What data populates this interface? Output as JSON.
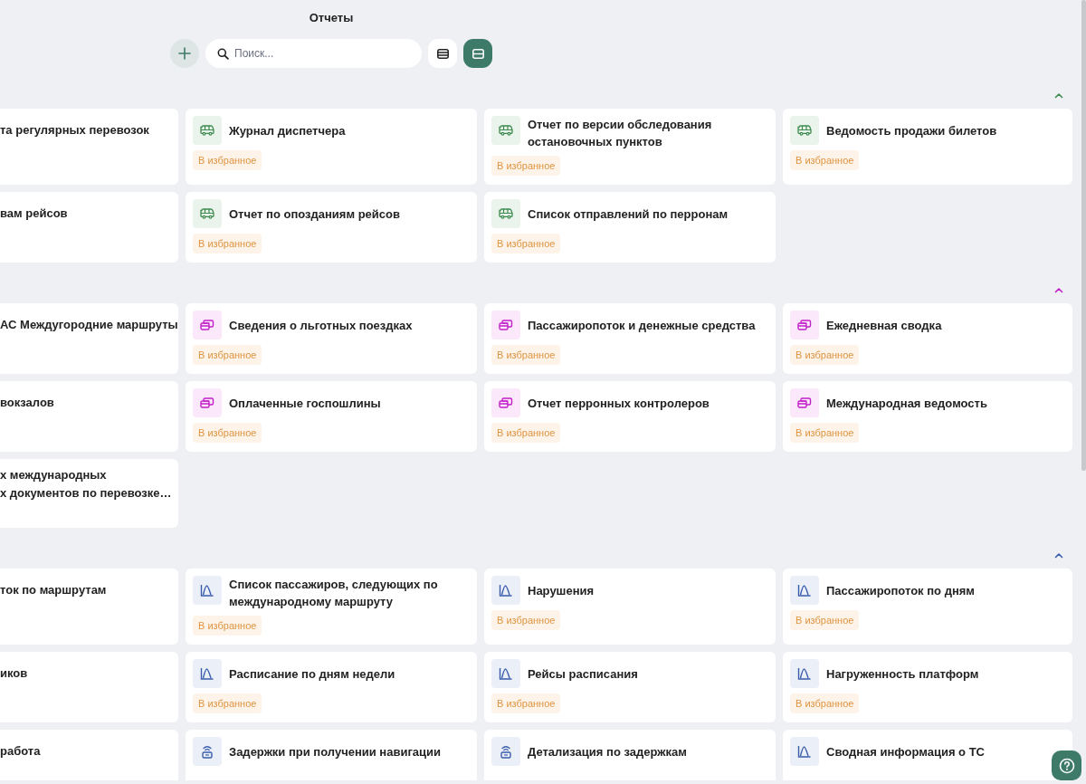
{
  "header": {
    "title": "Отчеты"
  },
  "toolbar": {
    "search": {
      "placeholder": "Поиск..."
    },
    "views": [
      {
        "kind": "list",
        "selected": false
      },
      {
        "kind": "cards",
        "selected": true
      }
    ]
  },
  "sections": [
    {
      "color": "#3d8a4f",
      "cards": [
        {
          "kind": "clipped",
          "lines": [
            "та регулярных перевозок"
          ]
        },
        {
          "kind": "bus",
          "title": "Журнал диспетчера",
          "favorite": "В избранное"
        },
        {
          "kind": "bus",
          "title": "Отчет по версии обследования остановочных пунктов",
          "favorite": "В избранное"
        },
        {
          "kind": "bus",
          "title": "Ведомость продажи билетов",
          "favorite": "В избранное"
        },
        {
          "kind": "clipped",
          "lines": [
            "вам рейсов"
          ]
        },
        {
          "kind": "bus",
          "title": "Отчет по опозданиям рейсов",
          "favorite": "В избранное"
        },
        {
          "kind": "bus",
          "title": "Список отправлений по перронам",
          "favorite": "В избранное"
        }
      ]
    },
    {
      "color": "#c21fc9",
      "cards": [
        {
          "kind": "clipped",
          "lines": [
            "АС Междугородние маршруты"
          ]
        },
        {
          "kind": "money",
          "title": "Сведения о льготных поездках",
          "favorite": "В избранное"
        },
        {
          "kind": "money",
          "title": "Пассажиропоток и денежные средства",
          "favorite": "В избранное"
        },
        {
          "kind": "money",
          "title": "Ежедневная сводка",
          "favorite": "В избранное"
        },
        {
          "kind": "clipped",
          "lines": [
            "вокзалов"
          ]
        },
        {
          "kind": "money",
          "title": "Оплаченные госпошлины",
          "favorite": "В избранное"
        },
        {
          "kind": "money",
          "title": "Отчет перронных контролеров",
          "favorite": "В избранное"
        },
        {
          "kind": "money",
          "title": "Международная ведомость",
          "favorite": "В избранное"
        },
        {
          "kind": "clipped",
          "lines": [
            "х международных",
            "х документов по перевозке…"
          ]
        }
      ]
    },
    {
      "color": "#3a5cad",
      "cards": [
        {
          "kind": "clipped",
          "lines": [
            "ток по маршрутам"
          ]
        },
        {
          "kind": "chart",
          "title": "Список пассажиров, следующих по международному маршруту",
          "favorite": "В избранное"
        },
        {
          "kind": "chart",
          "title": "Нарушения",
          "favorite": "В избранное"
        },
        {
          "kind": "chart",
          "title": "Пассажиропоток по дням",
          "favorite": "В избранное"
        },
        {
          "kind": "clipped",
          "lines": [
            "иков"
          ]
        },
        {
          "kind": "chart",
          "title": "Расписание по дням недели",
          "favorite": "В избранное"
        },
        {
          "kind": "chart",
          "title": "Рейсы расписания",
          "favorite": "В избранное"
        },
        {
          "kind": "chart",
          "title": "Нагруженность платформ",
          "favorite": "В избранное"
        },
        {
          "kind": "clipped",
          "lines": [
            "работа"
          ]
        },
        {
          "kind": "signal",
          "title": "Задержки при получении навигации"
        },
        {
          "kind": "signal",
          "title": "Детализация по задержкам"
        },
        {
          "kind": "chart",
          "title": "Сводная информация о ТС"
        }
      ]
    }
  ]
}
